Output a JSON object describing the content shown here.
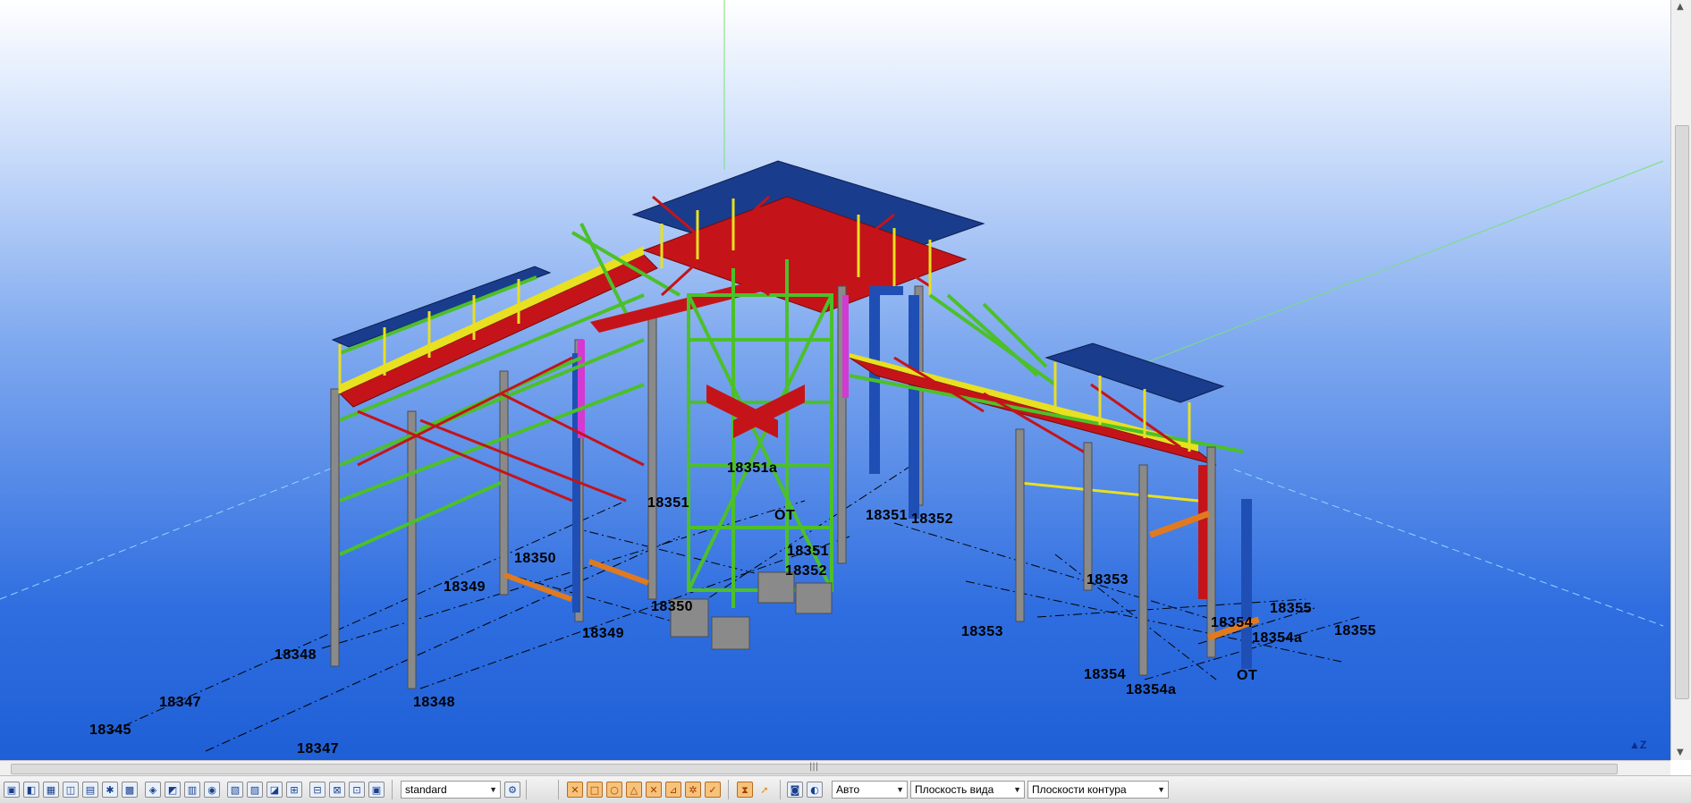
{
  "viewport": {
    "grid_labels": [
      {
        "id": "18345",
        "text": "18345"
      },
      {
        "id": "18347-a",
        "text": "18347"
      },
      {
        "id": "18347-b",
        "text": "18347"
      },
      {
        "id": "18348-a",
        "text": "18348"
      },
      {
        "id": "18348-b",
        "text": "18348"
      },
      {
        "id": "18349-a",
        "text": "18349"
      },
      {
        "id": "18349-b",
        "text": "18349"
      },
      {
        "id": "18350-a",
        "text": "18350"
      },
      {
        "id": "18350-b",
        "text": "18350"
      },
      {
        "id": "18351-a",
        "text": "18351"
      },
      {
        "id": "18351-b",
        "text": "18351"
      },
      {
        "id": "18351-c",
        "text": "18351"
      },
      {
        "id": "18351a",
        "text": "18351a"
      },
      {
        "id": "ot-a",
        "text": "OT"
      },
      {
        "id": "18352-a",
        "text": "18352"
      },
      {
        "id": "18352-b",
        "text": "18352"
      },
      {
        "id": "18353-a",
        "text": "18353"
      },
      {
        "id": "18353-b",
        "text": "18353"
      },
      {
        "id": "18354-a",
        "text": "18354"
      },
      {
        "id": "18354-b",
        "text": "18354"
      },
      {
        "id": "18354a-a",
        "text": "18354a"
      },
      {
        "id": "18354a-b",
        "text": "18354a"
      },
      {
        "id": "18355-a",
        "text": "18355"
      },
      {
        "id": "18355-b",
        "text": "18355"
      },
      {
        "id": "ot-b",
        "text": "OT"
      }
    ],
    "axis_icon_label": "Z",
    "colors": {
      "bg_top": "#ffffff",
      "bg_bottom": "#1f5fd6",
      "roof": "#1a3c8c",
      "deck": "#c4141a",
      "bracing": "#4cc02a",
      "columns": "#8a8a8a",
      "trim": "#e8e020"
    }
  },
  "toolbar": {
    "standard_select": "standard",
    "auto_select": "Авто",
    "view_plane_select": "Плоскость вида",
    "contour_planes_select": "Плоскости контура",
    "icons": [
      "select-all-icon",
      "select-part-icon",
      "select-assembly-icon",
      "select-component-icon",
      "select-cut-icon",
      "select-weld-icon",
      "select-grid-icon",
      "select-point-icon",
      "select-plane-icon",
      "select-view-icon",
      "select-bolt-icon",
      "select-reinforcement-icon",
      "select-surface-icon",
      "select-object-icon",
      "select-group-icon",
      "select-filter-icon",
      "snap-end-icon",
      "snap-mid-icon",
      "snap-circle-icon",
      "snap-intersection-icon",
      "snap-perpendicular-icon",
      "snap-line-icon",
      "snap-free-icon",
      "snap-reference-icon",
      "arrow-icon",
      "camera-icon",
      "render-icon"
    ]
  }
}
